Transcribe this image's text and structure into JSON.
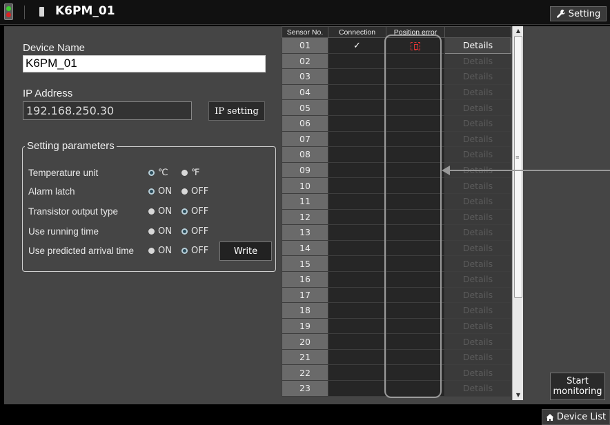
{
  "header": {
    "device_title": "K6PM_01",
    "setting_label": "Setting"
  },
  "device": {
    "name_label": "Device Name",
    "name_value": "K6PM_01",
    "ip_label": "IP Address",
    "ip_value": "192.168.250.30",
    "ip_setting_label": "IP setting"
  },
  "params": {
    "title": "Setting parameters",
    "rows": [
      {
        "label": "Temperature unit",
        "opt1": "℃",
        "opt2": "℉",
        "selected": "opt1"
      },
      {
        "label": "Alarm latch",
        "opt1": "ON",
        "opt2": "OFF",
        "selected": "opt1"
      },
      {
        "label": "Transistor output type",
        "opt1": "ON",
        "opt2": "OFF",
        "selected": "opt2"
      },
      {
        "label": "Use running time",
        "opt1": "ON",
        "opt2": "OFF",
        "selected": "opt2"
      },
      {
        "label": "Use predicted arrival time",
        "opt1": "ON",
        "opt2": "OFF",
        "selected": "opt2"
      }
    ],
    "write_label": "Write"
  },
  "table": {
    "headers": [
      "Sensor No.",
      "Connection",
      "Position error",
      ""
    ],
    "details_label": "Details",
    "connection_mark": "✓",
    "rows": [
      "01",
      "02",
      "03",
      "04",
      "05",
      "06",
      "07",
      "08",
      "09",
      "10",
      "11",
      "12",
      "13",
      "14",
      "15",
      "16",
      "17",
      "18",
      "19",
      "20",
      "21",
      "22",
      "23"
    ],
    "connected_rows": [
      "01"
    ]
  },
  "start_monitoring": {
    "line1": "Start",
    "line2": "monitoring"
  },
  "footer": {
    "device_list_label": "Device List"
  },
  "colors": {
    "panel_bg": "#454545",
    "title_bg": "#111111",
    "selected_radio": "#b9cfd8",
    "error_icon": "#dd3333"
  },
  "icons": [
    "status-led-icon",
    "device-icon",
    "wrench-icon",
    "position-error-icon",
    "home-icon",
    "scroll-up-icon",
    "scroll-down-icon"
  ]
}
